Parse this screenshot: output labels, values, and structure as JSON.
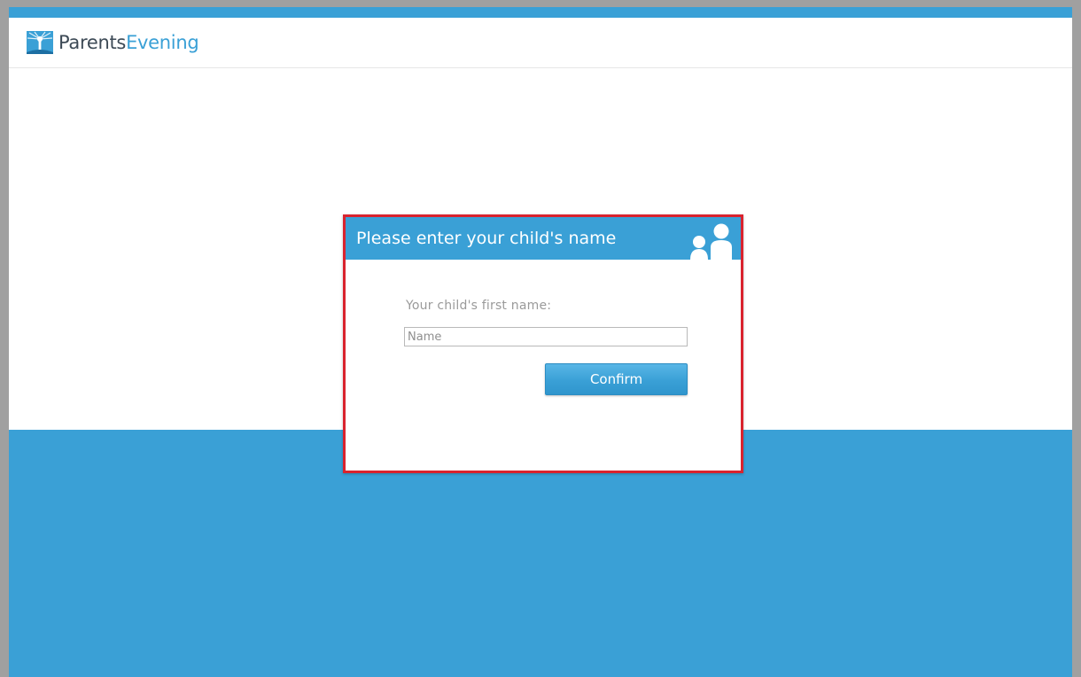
{
  "header": {
    "logo_part1": "Parents",
    "logo_part2": "Evening",
    "logo_icon": "parents-evening-logo-icon"
  },
  "dialog": {
    "title": "Please enter your child's name",
    "icon": "people-icon",
    "field_label": "Your child's first name:",
    "input_placeholder": "Name",
    "input_value": "",
    "confirm_label": "Confirm"
  },
  "colors": {
    "brand_blue": "#3aa0d6",
    "dark_text": "#3d4a56",
    "highlight_border": "#d9232e",
    "frame_gray": "#a0a0a0"
  }
}
